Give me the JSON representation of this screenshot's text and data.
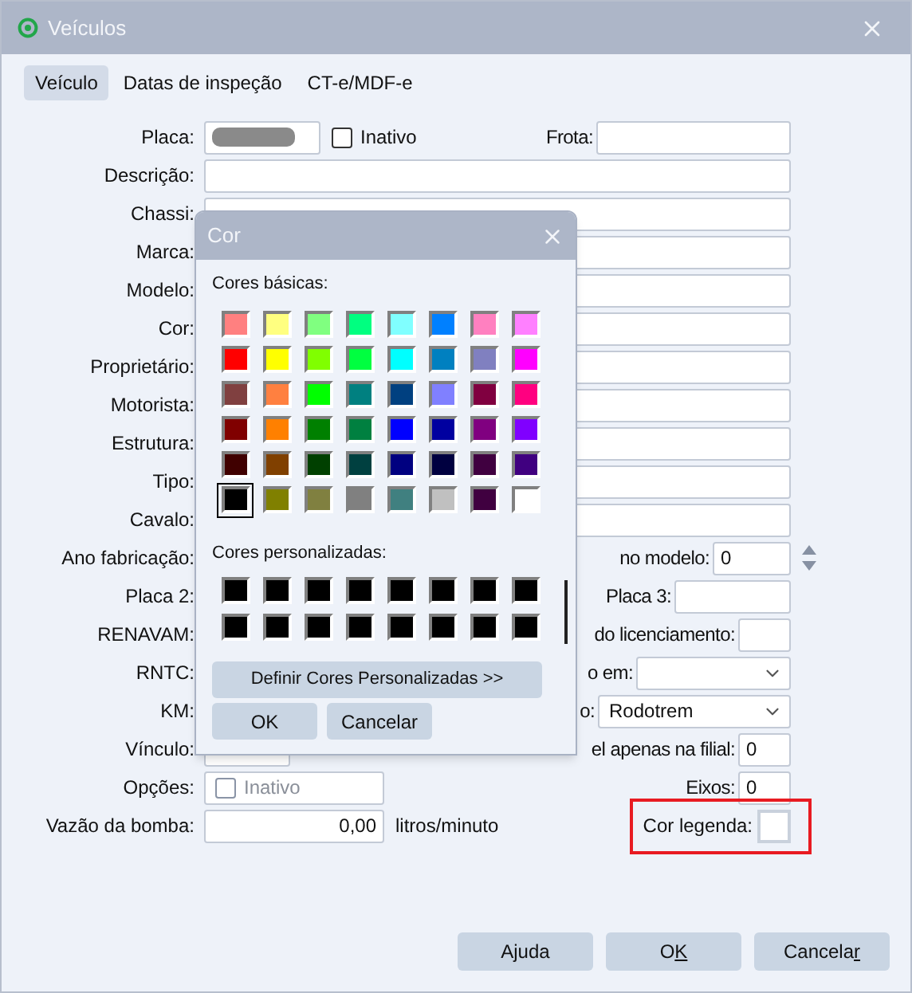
{
  "window": {
    "title": "Veículos"
  },
  "tabs": [
    {
      "label": "Veículo",
      "selected": true
    },
    {
      "label": "Datas de inspeção",
      "selected": false
    },
    {
      "label": "CT-e/MDF-e",
      "selected": false
    }
  ],
  "rows": [
    {
      "label": "Placa:",
      "kind": "placa",
      "redacted": true,
      "checkbox": {
        "label": "Inativo",
        "checked": false,
        "disabled": false
      },
      "right": {
        "label": "Frota:",
        "kind": "frota"
      }
    },
    {
      "label": "Descrição:",
      "kind": "wide"
    },
    {
      "label": "Chassi:",
      "kind": "wide"
    },
    {
      "label": "Marca:",
      "kind": "wide"
    },
    {
      "label": "Modelo:",
      "kind": "wide"
    },
    {
      "label": "Cor:",
      "kind": "wide"
    },
    {
      "label": "Proprietário:",
      "kind": "wide"
    },
    {
      "label": "Motorista:",
      "kind": "wide"
    },
    {
      "label": "Estrutura:",
      "kind": "wide"
    },
    {
      "label": "Tipo:",
      "kind": "wide"
    },
    {
      "label": "Cavalo:",
      "kind": "wide"
    },
    {
      "label": "Ano fabricação:",
      "kind": "covered",
      "right": {
        "label": "no modelo:",
        "kind": "spin",
        "value": "0"
      }
    },
    {
      "label": "Placa 2:",
      "kind": "covered",
      "right": {
        "label": "Placa 3:",
        "kind": "text"
      }
    },
    {
      "label": "RENAVAM:",
      "kind": "covered",
      "right": {
        "label": "do licenciamento:",
        "kind": "small"
      }
    },
    {
      "label": "RNTC:",
      "kind": "covered",
      "right": {
        "label": "o em:",
        "kind": "select"
      }
    },
    {
      "label": "KM:",
      "kind": "covered",
      "right": {
        "label": "o:",
        "kind": "select-wide",
        "value": "Rodotrem"
      }
    },
    {
      "label": "Vínculo:",
      "kind": "short",
      "right": {
        "label": "el apenas na filial:",
        "kind": "small",
        "value": "0"
      }
    },
    {
      "label": "Opções:",
      "kind": "options",
      "checkbox": {
        "label": "Inativo",
        "checked": false,
        "disabled": true
      },
      "right": {
        "label": "Eixos:",
        "kind": "small",
        "value": "0"
      }
    },
    {
      "label": "Vazão da bomba:",
      "kind": "number",
      "value": "0,00",
      "unit": "litros/minuto",
      "right": {
        "label": "Cor legenda:",
        "kind": "color",
        "highlighted": true
      }
    }
  ],
  "color_dialog": {
    "title": "Cor",
    "basic_label": "Cores básicas:",
    "basic_colors": [
      {
        "color": "#ff8080",
        "selected": false
      },
      {
        "color": "#ffff80",
        "selected": false
      },
      {
        "color": "#80ff80",
        "selected": false
      },
      {
        "color": "#00ff80",
        "selected": false
      },
      {
        "color": "#80ffff",
        "selected": false
      },
      {
        "color": "#0080ff",
        "selected": false
      },
      {
        "color": "#ff80c0",
        "selected": false
      },
      {
        "color": "#ff80ff",
        "selected": false
      },
      {
        "color": "#ff0000",
        "selected": false
      },
      {
        "color": "#ffff00",
        "selected": false
      },
      {
        "color": "#80ff00",
        "selected": false
      },
      {
        "color": "#00ff40",
        "selected": false
      },
      {
        "color": "#00ffff",
        "selected": false
      },
      {
        "color": "#0080c0",
        "selected": false
      },
      {
        "color": "#8080c0",
        "selected": false
      },
      {
        "color": "#ff00ff",
        "selected": false
      },
      {
        "color": "#804040",
        "selected": false
      },
      {
        "color": "#ff8040",
        "selected": false
      },
      {
        "color": "#00ff00",
        "selected": false
      },
      {
        "color": "#008080",
        "selected": false
      },
      {
        "color": "#004080",
        "selected": false
      },
      {
        "color": "#8080ff",
        "selected": false
      },
      {
        "color": "#800040",
        "selected": false
      },
      {
        "color": "#ff0080",
        "selected": false
      },
      {
        "color": "#800000",
        "selected": false
      },
      {
        "color": "#ff8000",
        "selected": false
      },
      {
        "color": "#008000",
        "selected": false
      },
      {
        "color": "#008040",
        "selected": false
      },
      {
        "color": "#0000ff",
        "selected": false
      },
      {
        "color": "#0000a0",
        "selected": false
      },
      {
        "color": "#800080",
        "selected": false
      },
      {
        "color": "#8000ff",
        "selected": false
      },
      {
        "color": "#400000",
        "selected": false
      },
      {
        "color": "#804000",
        "selected": false
      },
      {
        "color": "#004000",
        "selected": false
      },
      {
        "color": "#004040",
        "selected": false
      },
      {
        "color": "#000080",
        "selected": false
      },
      {
        "color": "#000040",
        "selected": false
      },
      {
        "color": "#400040",
        "selected": false
      },
      {
        "color": "#400080",
        "selected": false
      },
      {
        "color": "#000000",
        "selected": true
      },
      {
        "color": "#808000",
        "selected": false
      },
      {
        "color": "#808040",
        "selected": false
      },
      {
        "color": "#808080",
        "selected": false
      },
      {
        "color": "#408080",
        "selected": false
      },
      {
        "color": "#c0c0c0",
        "selected": false
      },
      {
        "color": "#400040",
        "selected": false
      },
      {
        "color": "#ffffff",
        "selected": false
      }
    ],
    "custom_label": "Cores personalizadas:",
    "custom_colors": [
      {
        "color": "#000000"
      },
      {
        "color": "#000000"
      },
      {
        "color": "#000000"
      },
      {
        "color": "#000000"
      },
      {
        "color": "#000000"
      },
      {
        "color": "#000000"
      },
      {
        "color": "#000000"
      },
      {
        "color": "#000000"
      },
      {
        "color": "#000000"
      },
      {
        "color": "#000000"
      },
      {
        "color": "#000000"
      },
      {
        "color": "#000000"
      },
      {
        "color": "#000000"
      },
      {
        "color": "#000000"
      },
      {
        "color": "#000000"
      },
      {
        "color": "#000000"
      }
    ],
    "define_button": "Definir Cores Personalizadas >>",
    "buttons": [
      "OK",
      "Cancelar"
    ]
  },
  "buttons": [
    {
      "label": "Ajuda",
      "underline_last": false
    },
    {
      "label": "OK",
      "underline_last": true
    },
    {
      "label": "Cancelar",
      "underline_last": true
    }
  ]
}
